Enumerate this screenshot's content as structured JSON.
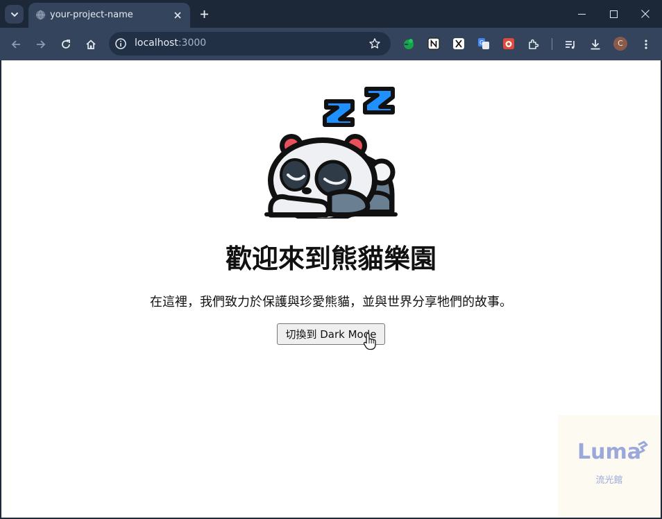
{
  "browser": {
    "tab_title": "your-project-name",
    "url_host": "localhost",
    "url_port": ":3000"
  },
  "page": {
    "title": "歡迎來到熊貓樂園",
    "description": "在這裡，我們致力於保護與珍愛熊貓，並與世界分享牠們的故事。",
    "toggle_button_label": "切換到 Dark Mode"
  },
  "watermark": {
    "logo_text": "Luma",
    "subtitle": "流光館"
  },
  "profile": {
    "avatar_initial": "C"
  },
  "colors": {
    "chrome_frame": "#1c2738",
    "toolbar": "#34445c",
    "page_background": "#ffffff",
    "panda_zzz_blue": "#1e90ff",
    "panda_ear_red": "#e8505b"
  }
}
